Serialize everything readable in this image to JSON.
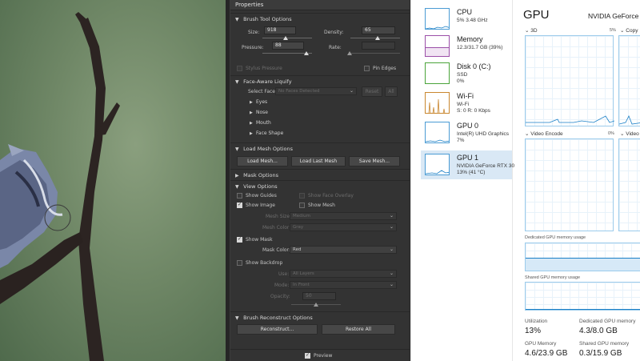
{
  "properties_panel": {
    "title": "Properties",
    "brush_tool_options": {
      "heading": "Brush Tool Options",
      "size": {
        "label": "Size:",
        "value": "918"
      },
      "density": {
        "label": "Density:",
        "value": "65"
      },
      "pressure": {
        "label": "Pressure:",
        "value": "88"
      },
      "rate": {
        "label": "Rate:",
        "value": ""
      },
      "stylus_pressure": "Stylus Pressure",
      "pin_edges": "Pin Edges"
    },
    "face_aware_liquify": {
      "heading": "Face-Aware Liquify",
      "select_face_label": "Select Face:",
      "select_face_value": "No Faces Detected",
      "reset_button": "Reset",
      "all_button": "All",
      "subsections": [
        "Eyes",
        "Nose",
        "Mouth",
        "Face Shape"
      ]
    },
    "load_mesh_options": {
      "heading": "Load Mesh Options",
      "load_mesh": "Load Mesh...",
      "load_last_mesh": "Load Last Mesh",
      "save_mesh": "Save Mesh..."
    },
    "mask_options": {
      "heading": "Mask Options"
    },
    "view_options": {
      "heading": "View Options",
      "show_guides": "Show Guides",
      "show_face_overlay": "Show Face Overlay",
      "show_image": "Show Image",
      "show_mesh": "Show Mesh",
      "mesh_size_label": "Mesh Size:",
      "mesh_size_value": "Medium",
      "mesh_color_label": "Mesh Color:",
      "mesh_color_value": "Gray",
      "show_mask": "Show Mask",
      "mask_color_label": "Mask Color:",
      "mask_color_value": "Red",
      "show_backdrop": "Show Backdrop",
      "use_label": "Use:",
      "use_value": "All Layers",
      "mode_label": "Mode:",
      "mode_value": "In Front",
      "opacity_label": "Opacity:",
      "opacity_value": "50"
    },
    "brush_reconstruct_options": {
      "heading": "Brush Reconstruct Options",
      "reconstruct": "Reconstruct...",
      "restore_all": "Restore All"
    },
    "preview": "Preview"
  },
  "task_manager": {
    "resources": [
      {
        "name": "CPU",
        "line1": "5% 3.48 GHz",
        "line2": ""
      },
      {
        "name": "Memory",
        "line1": "12.3/31.7 GB (39%)",
        "line2": ""
      },
      {
        "name": "Disk 0 (C:)",
        "line1": "SSD",
        "line2": "0%"
      },
      {
        "name": "Wi-Fi",
        "line1": "Wi-Fi",
        "line2": "S: 0 R: 0 Kbps"
      },
      {
        "name": "GPU 0",
        "line1": "Intel(R) UHD Graphics",
        "line2": "7%"
      },
      {
        "name": "GPU 1",
        "line1": "NVIDIA GeForce RTX 30",
        "line2": "13% (41 °C)"
      }
    ],
    "detail": {
      "title": "GPU",
      "gpu_name": "NVIDIA GeForce",
      "graph_3d": "3D",
      "graph_3d_pct": "5%",
      "graph_copy": "Copy",
      "graph_video_encode": "Video Encode",
      "graph_video_encode_pct": "0%",
      "graph_video": "Video",
      "dedicated_memory_label": "Dedicated GPU memory usage",
      "shared_memory_label": "Shared GPU memory usage",
      "utilization_label": "Utilization",
      "utilization_value": "13%",
      "dedicated_label": "Dedicated GPU memory",
      "dedicated_value": "4.3/8.0 GB",
      "gpu_memory_label": "GPU Memory",
      "gpu_memory_value": "4.6/23.9 GB",
      "shared_label": "Shared GPU memory",
      "shared_value": "0.3/15.9 GB"
    }
  }
}
